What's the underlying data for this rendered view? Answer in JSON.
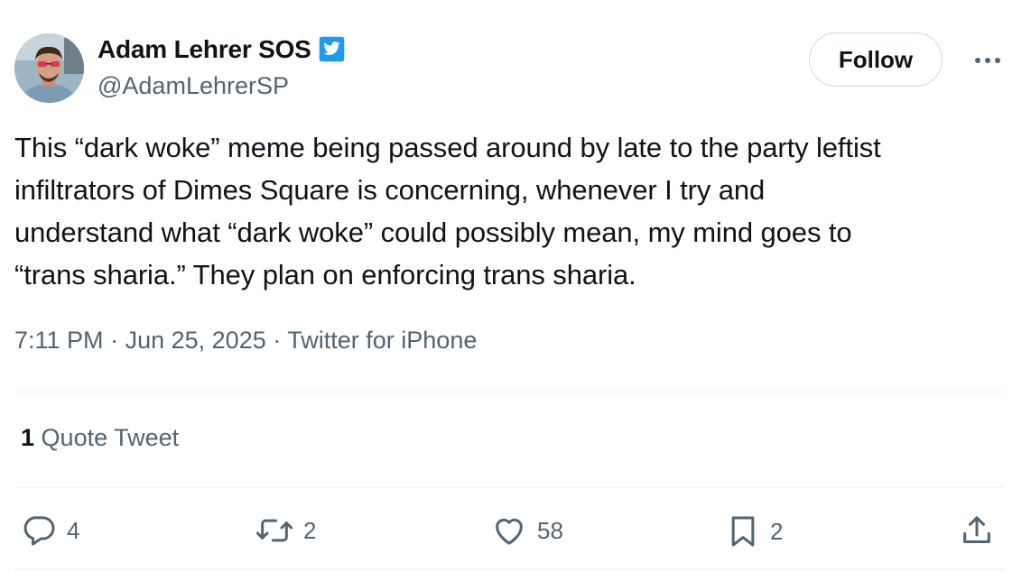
{
  "author": {
    "display_name": "Adam Lehrer SOS",
    "handle": "@AdamLehrerSP",
    "verified_color": "#1d9bf0"
  },
  "header": {
    "follow_label": "Follow",
    "more_icon": "more-horizontal-icon"
  },
  "tweet": {
    "lines": [
      "This “dark woke” meme being passed around by late to the party leftist",
      "infiltrators of Dimes Square is concerning, whenever I try and",
      "understand what “dark woke” could possibly mean, my mind goes to",
      "“trans sharia.” They plan on enforcing trans sharia."
    ],
    "time": "7:11 PM",
    "separator": "·",
    "date": "Jun 25, 2025",
    "source": "Twitter for iPhone"
  },
  "engagement": {
    "quote_count": "1",
    "quote_label": "Quote Tweet"
  },
  "actions": {
    "reply": {
      "icon": "reply-icon",
      "count": "4"
    },
    "retweet": {
      "icon": "retweet-icon",
      "count": "2"
    },
    "like": {
      "icon": "like-heart-icon",
      "count": "58"
    },
    "bookmark": {
      "icon": "bookmark-icon",
      "count": "2"
    },
    "share": {
      "icon": "share-icon"
    }
  },
  "colors": {
    "text_primary": "#0f1419",
    "text_secondary": "#536471",
    "divider": "#eff3f4",
    "border": "#cfd9de"
  }
}
